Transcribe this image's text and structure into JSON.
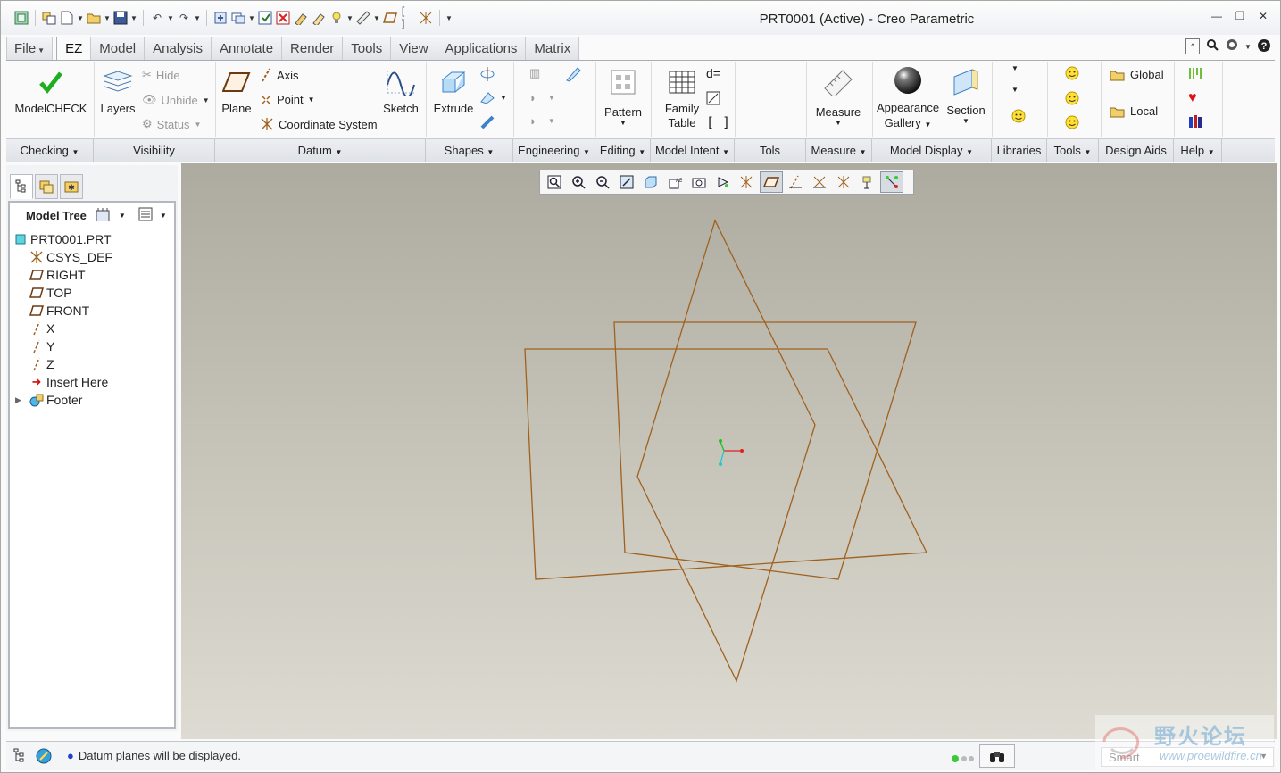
{
  "window": {
    "title": "PRT0001 (Active) - Creo Parametric"
  },
  "tabs": [
    "File",
    "EZ",
    "Model",
    "Analysis",
    "Annotate",
    "Render",
    "Tools",
    "View",
    "Applications",
    "Matrix"
  ],
  "active_tab": "EZ",
  "ribbon": {
    "modelcheck": "ModelCHECK",
    "layers": "Layers",
    "hide": "Hide",
    "unhide": "Unhide",
    "status": "Status",
    "plane": "Plane",
    "axis": "Axis",
    "point": "Point",
    "coordinate_system": "Coordinate System",
    "sketch": "Sketch",
    "extrude": "Extrude",
    "pattern": "Pattern",
    "family_table_1": "Family",
    "family_table_2": "Table",
    "measure": "Measure",
    "appearance_gallery_1": "Appearance",
    "appearance_gallery_2": "Gallery",
    "section": "Section",
    "global": "Global",
    "local": "Local",
    "d_equals": "d="
  },
  "groups": [
    "Checking",
    "Visibility",
    "Datum",
    "Shapes",
    "Engineering",
    "Editing",
    "Model Intent",
    "Tols",
    "Measure",
    "Model Display",
    "Libraries",
    "Tools",
    "Design Aids",
    "Help"
  ],
  "model_tree": {
    "title": "Model Tree",
    "items": [
      "PRT0001.PRT",
      "CSYS_DEF",
      "RIGHT",
      "TOP",
      "FRONT",
      "X",
      "Y",
      "Z",
      "Insert Here",
      "Footer"
    ]
  },
  "status": {
    "message": "Datum planes will be displayed.",
    "filter": "Smart"
  },
  "colors": {
    "plane_edges": "#a0611e",
    "viewport_top": "#adaba0",
    "viewport_bottom": "#dddbd2",
    "csys_x": "#e02020",
    "csys_y": "#20c020",
    "csys_z": "#20c8d0"
  },
  "watermark": {
    "cn": "野火论坛",
    "url": "www.proewildfire.cn"
  }
}
